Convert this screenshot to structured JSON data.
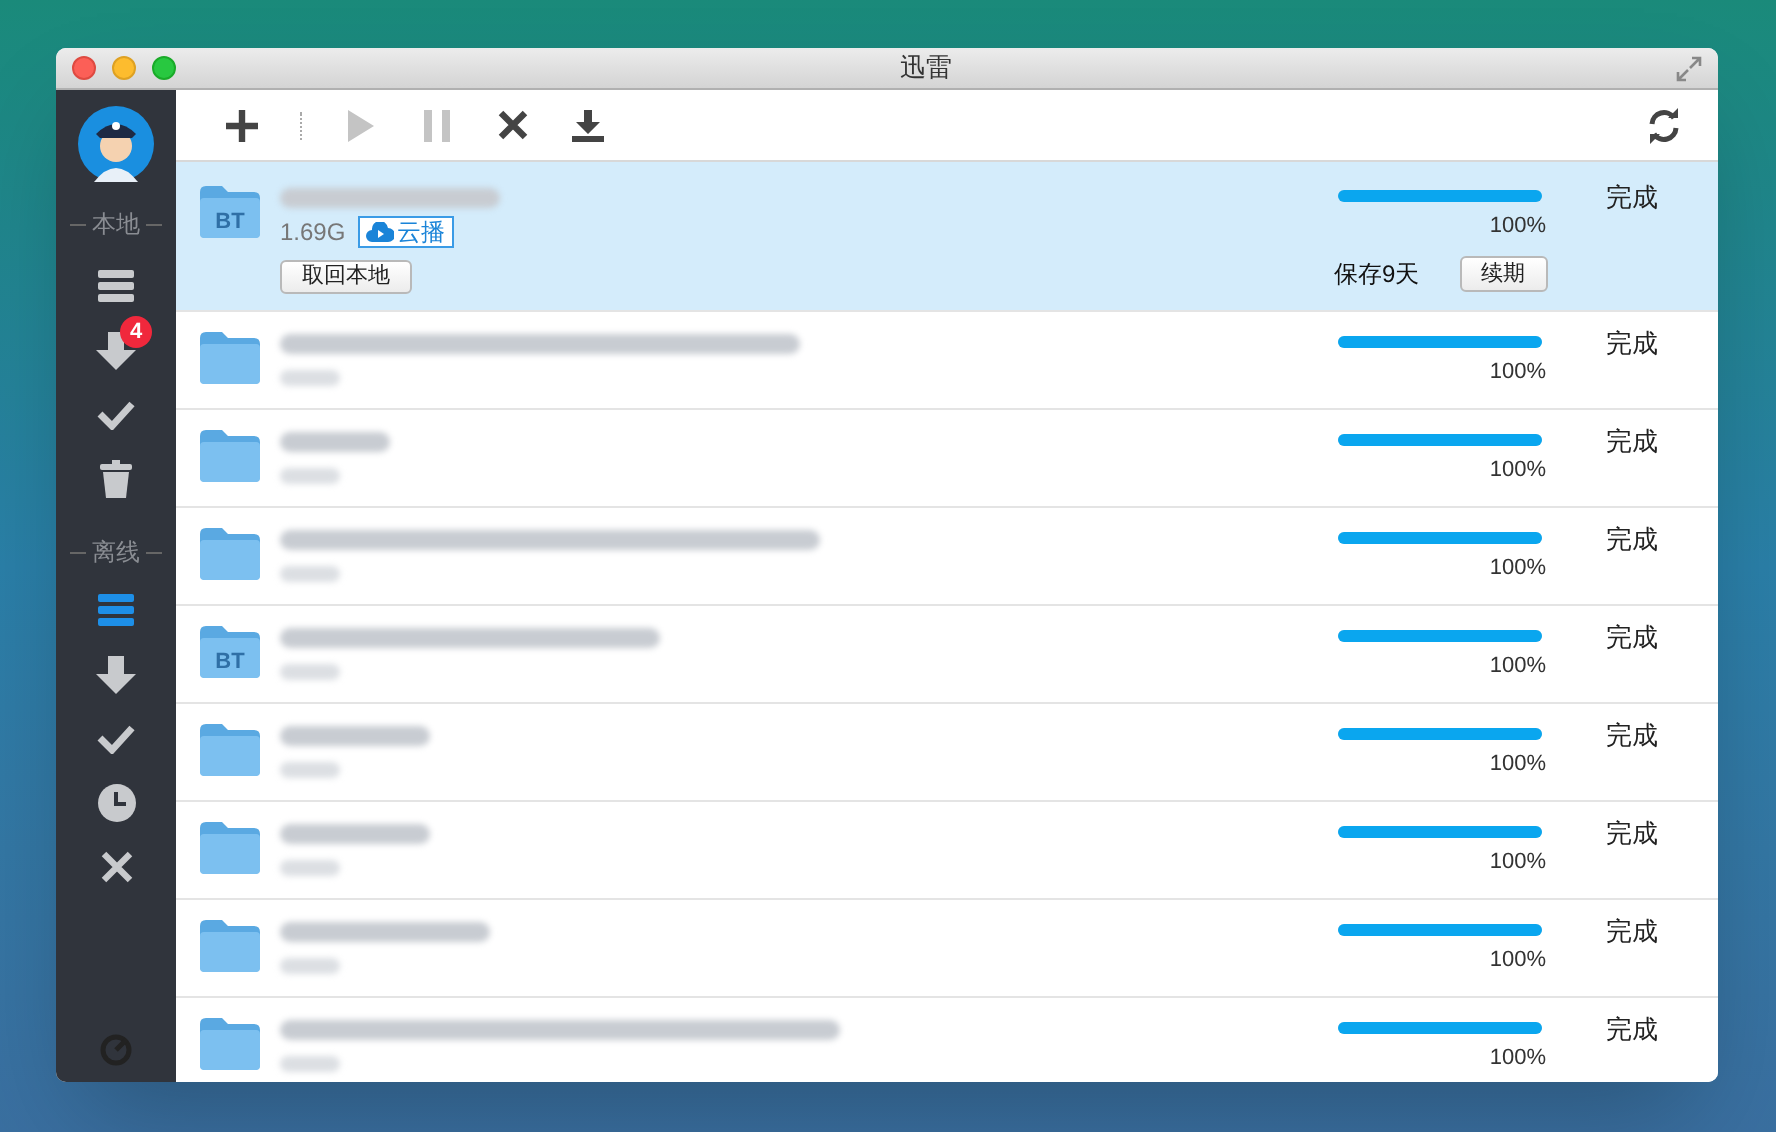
{
  "window": {
    "title": "迅雷"
  },
  "sidebar": {
    "sections": [
      {
        "label": "本地",
        "items": [
          {
            "kind": "list",
            "selected": false
          },
          {
            "kind": "download",
            "selected": false,
            "badge": "4"
          },
          {
            "kind": "check",
            "selected": false
          },
          {
            "kind": "trash",
            "selected": false
          }
        ]
      },
      {
        "label": "离线",
        "items": [
          {
            "kind": "list",
            "selected": true
          },
          {
            "kind": "download",
            "selected": false
          },
          {
            "kind": "check",
            "selected": false
          },
          {
            "kind": "clock",
            "selected": false
          },
          {
            "kind": "cross",
            "selected": false
          }
        ]
      }
    ]
  },
  "toolbar": [
    {
      "kind": "add",
      "disabled": false
    },
    {
      "kind": "separator"
    },
    {
      "kind": "play",
      "disabled": true
    },
    {
      "kind": "pause",
      "disabled": true
    },
    {
      "kind": "delete",
      "disabled": false
    },
    {
      "kind": "download",
      "disabled": false
    }
  ],
  "tasks": [
    {
      "selected": true,
      "badge": "BT",
      "size": "1.69G",
      "cloud_button": "云播",
      "retrieve_button": "取回本地",
      "retention": "保存9天",
      "renew_button": "续期",
      "level": 1,
      "percent": "100%",
      "status": "完成"
    },
    {
      "selected": false,
      "level": 1,
      "percent": "100%",
      "status": "完成"
    },
    {
      "selected": false,
      "level": 1,
      "percent": "100%",
      "status": "完成"
    },
    {
      "selected": false,
      "level": 1,
      "percent": "100%",
      "status": "完成"
    },
    {
      "selected": false,
      "badge": "BT",
      "level": 1,
      "percent": "100%",
      "status": "完成"
    },
    {
      "selected": false,
      "level": 1,
      "percent": "100%",
      "status": "完成"
    },
    {
      "selected": false,
      "level": 1,
      "percent": "100%",
      "status": "完成"
    },
    {
      "selected": false,
      "level": 1,
      "percent": "100%",
      "status": "完成"
    },
    {
      "selected": false,
      "level": 1,
      "percent": "100%",
      "status": "完成"
    }
  ]
}
